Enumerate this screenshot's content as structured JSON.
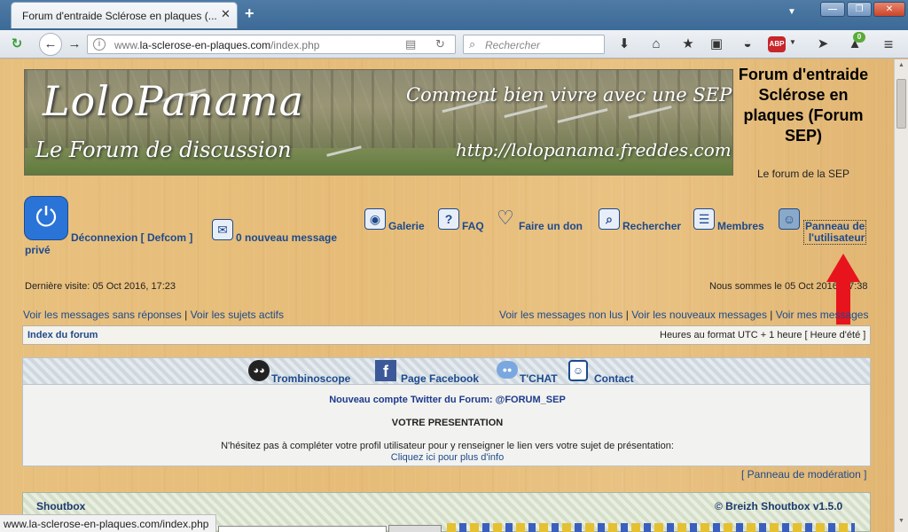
{
  "browser": {
    "tab_title": "Forum d'entraide Sclérose en plaques (...",
    "tab_close": "✕",
    "new_tab": "+",
    "tab_list": "▼",
    "win_min": "—",
    "win_max": "❐",
    "win_close": "✕",
    "url_prefix": "www.",
    "url_domain": "la-sclerose-en-plaques.com",
    "url_path": "/index.php",
    "search_placeholder": "Rechercher",
    "abp": "ABP",
    "notif_count": "0",
    "status_url": "www.la-sclerose-en-plaques.com/index.php",
    "icons": [
      "reload-icon",
      "back-icon",
      "forward-icon",
      "info-icon",
      "reader-icon",
      "refresh-icon",
      "search-icon",
      "download-icon",
      "home-icon",
      "bookmark-star-icon",
      "reading-list-icon",
      "pocket-icon",
      "adblock-icon",
      "send-icon",
      "notification-icon",
      "menu-icon"
    ]
  },
  "banner": {
    "logo": "LoloPanama",
    "subtitle": "Le Forum de discussion",
    "tagline": "Comment bien vivre avec une SEP",
    "url": "http://lolopanama.freddes.com"
  },
  "forum": {
    "title": "Forum d'entraide Sclérose en plaques (Forum SEP)",
    "description": "Le forum de la SEP"
  },
  "nav": {
    "logout": "Déconnexion [ Defcom ]",
    "private_word": "privé",
    "messages": "0 nouveau message",
    "gallery": "Galerie",
    "faq": "FAQ",
    "donate": "Faire un don",
    "search": "Rechercher",
    "members": "Membres",
    "ucp_line1": "Panneau de",
    "ucp_line2": "l'utilisateur"
  },
  "info": {
    "last_visit": "Dernière visite: 05 Oct 2016, 17:23",
    "now": "Nous sommes le 05 Oct 2016, 17:38"
  },
  "links_left": [
    "Voir les messages sans réponses",
    "Voir les sujets actifs"
  ],
  "links_right": [
    "Voir les messages non lus",
    "Voir les nouveaux messages",
    "Voir mes messages"
  ],
  "breadcrumb": {
    "index": "Index du forum",
    "timezone": "Heures au format UTC + 1 heure [ Heure d'été ]"
  },
  "tiles": {
    "trombinoscope": "Trombinoscope",
    "facebook": "Page Facebook",
    "chat": "T'CHAT",
    "contact": "Contact"
  },
  "announce": {
    "twitter": "Nouveau compte Twitter du Forum: @FORUM_SEP",
    "title": "VOTRE PRESENTATION",
    "text": "N'hésitez pas à compléter votre profil utilisateur pour y renseigner le lien vers votre sujet de présentation:",
    "link": "Cliquez ici pour plus d'info"
  },
  "moderation": "[ Panneau de modération ]",
  "shoutbox": {
    "title": "Shoutbox",
    "version": "© Breizh Shoutbox v1.5.0"
  },
  "colors": {
    "link": "#1d4a8c",
    "arrow": "#e8141d",
    "titlebar": "#3c6a96"
  }
}
